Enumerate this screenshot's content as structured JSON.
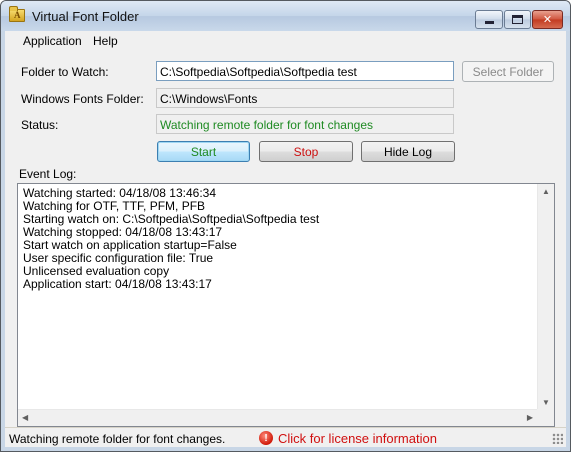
{
  "window": {
    "title": "Virtual Font Folder"
  },
  "menu": {
    "items": [
      "Application",
      "Help"
    ]
  },
  "form": {
    "folder_label": "Folder to Watch:",
    "folder_value": "C:\\Softpedia\\Softpedia\\Softpedia test",
    "select_folder_button": "Select Folder",
    "fonts_label": "Windows Fonts Folder:",
    "fonts_value": "C:\\Windows\\Fonts",
    "status_label": "Status:",
    "status_value": "Watching remote folder for font changes",
    "status_color": "#1e8a22"
  },
  "buttons": {
    "start": "Start",
    "stop": "Stop",
    "hide_log": "Hide Log"
  },
  "event_log": {
    "label": "Event Log:",
    "lines": [
      "Watching started: 04/18/08 13:46:34",
      "Watching for OTF, TTF, PFM, PFB",
      "Starting watch on: C:\\Softpedia\\Softpedia\\Softpedia test",
      "Watching stopped: 04/18/08 13:43:17",
      "Start watch on application startup=False",
      "User specific configuration file: True",
      "Unlicensed evaluation copy",
      "Application start: 04/18/08 13:43:17"
    ]
  },
  "statusbar": {
    "text": "Watching remote folder for font changes.",
    "license_link": "Click for license information",
    "license_icon": "!",
    "license_color": "#d01010"
  },
  "icons": {
    "app": "folder-font-icon",
    "license": "error-icon",
    "minimize": "minimize-icon",
    "maximize": "maximize-icon",
    "close": "close-icon"
  }
}
